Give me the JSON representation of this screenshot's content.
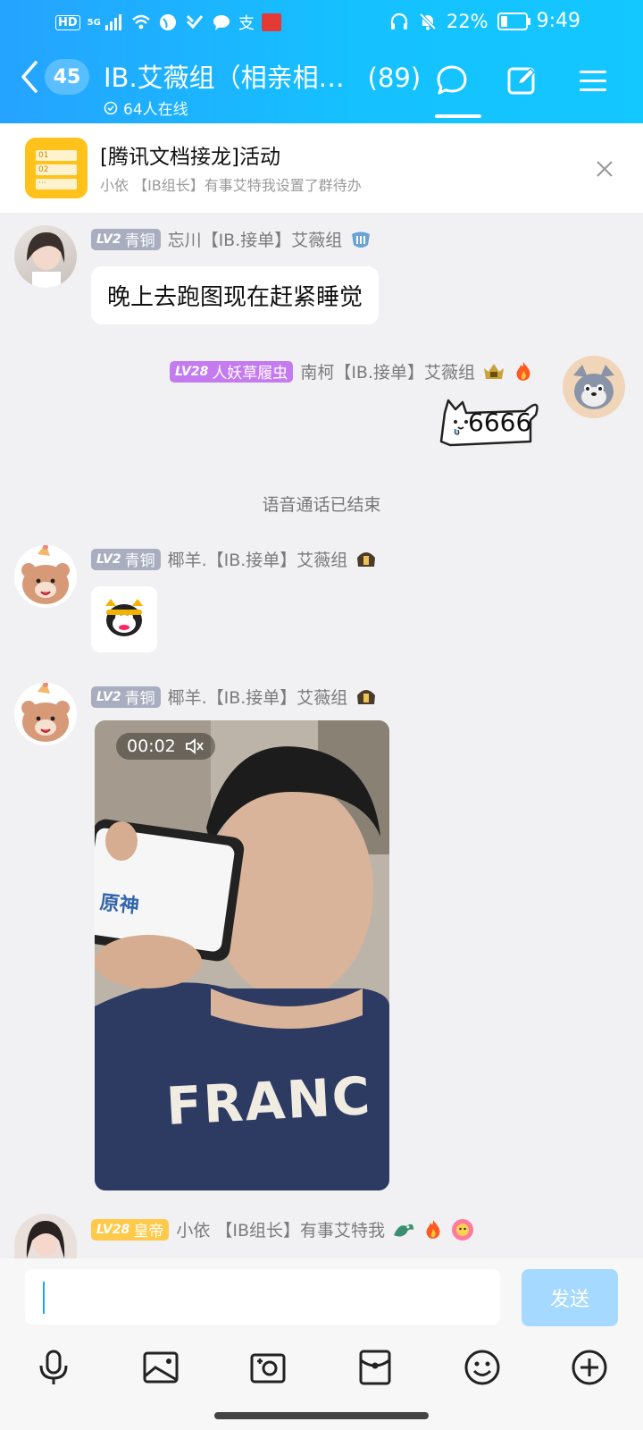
{
  "status": {
    "time": "9:49",
    "battery": "22%",
    "network": "5G",
    "hd": "HD",
    "alipay": "支"
  },
  "header": {
    "unread_badge": "45",
    "title": "IB.艾薇组（相亲相…",
    "member_count": "(89)",
    "online": "64人在线"
  },
  "notice": {
    "title": "[腾讯文档接龙]活动",
    "subtitle": "小依 【IB组长】有事艾特我设置了群待办",
    "icon_lines": [
      "01",
      "02",
      "···"
    ]
  },
  "messages": [
    {
      "level": "LV2",
      "rank": "青铜",
      "sender": "忘川【IB.接单】艾薇组",
      "text": "晚上去跑图现在赶紧睡觉"
    },
    {
      "level": "LV28",
      "rank": "人妖草履虫",
      "sender": "南柯【IB.接单】艾薇组",
      "sticker_text": "6666"
    },
    {
      "level": "LV2",
      "rank": "青铜",
      "sender": "椰羊.【IB.接单】艾薇组"
    },
    {
      "level": "LV2",
      "rank": "青铜",
      "sender": "椰羊.【IB.接单】艾薇组",
      "video_duration": "00:02",
      "video_screen_text": "原神",
      "video_shirt_text": "FRANC"
    },
    {
      "level": "LV28",
      "rank": "皇帝",
      "sender": "小依 【IB组长】有事艾特我"
    }
  ],
  "system_note": "语音通话已结束",
  "input": {
    "value": "",
    "send_label": "发送"
  },
  "colors": {
    "header_start": "#25a3ff",
    "header_end": "#13c7ff",
    "send_disabled": "#a6d9ff",
    "lv_gray": "#a8adc0",
    "lv_purple": "#c47bf0",
    "lv_gold": "#ffc94a"
  }
}
